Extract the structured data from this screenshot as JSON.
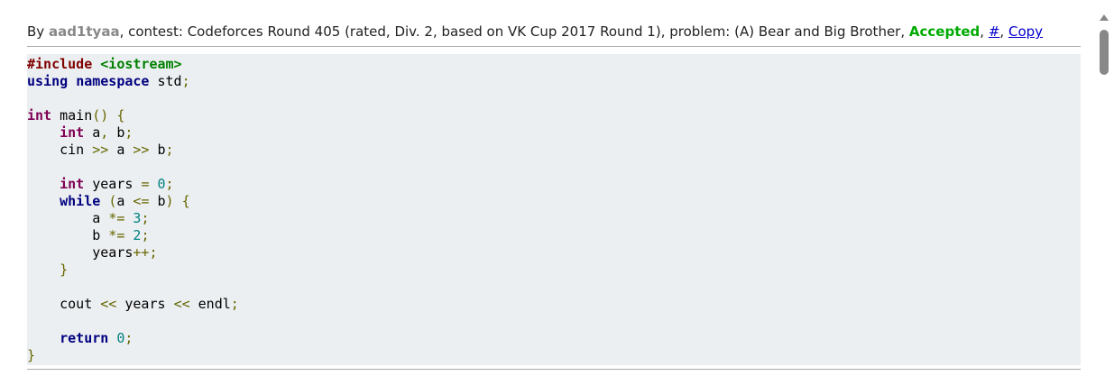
{
  "submission": {
    "by_label": "By",
    "author": "aad1tyaa",
    "contest_label": ", contest:",
    "contest": "Codeforces Round 405 (rated, Div. 2, based on VK Cup 2017 Round 1)",
    "problem_label": ", problem:",
    "problem": "(A) Bear and Big Brother",
    "verdict": "Accepted",
    "hash_link": "#",
    "copy_link": "Copy"
  },
  "code_lines": [
    "#include <iostream>",
    "using namespace std;",
    "",
    "int main() {",
    "    int a, b;",
    "    cin >> a >> b;",
    "",
    "    int years = 0;",
    "    while (a <= b) {",
    "        a *= 3;",
    "        b *= 2;",
    "        years++;",
    "    }",
    "",
    "    cout << years << endl;",
    "",
    "    return 0;",
    "}"
  ],
  "colors": {
    "verdict": "#00aa00",
    "author": "#888888",
    "link": "#0000cc",
    "code_bg": "#eceff1"
  }
}
